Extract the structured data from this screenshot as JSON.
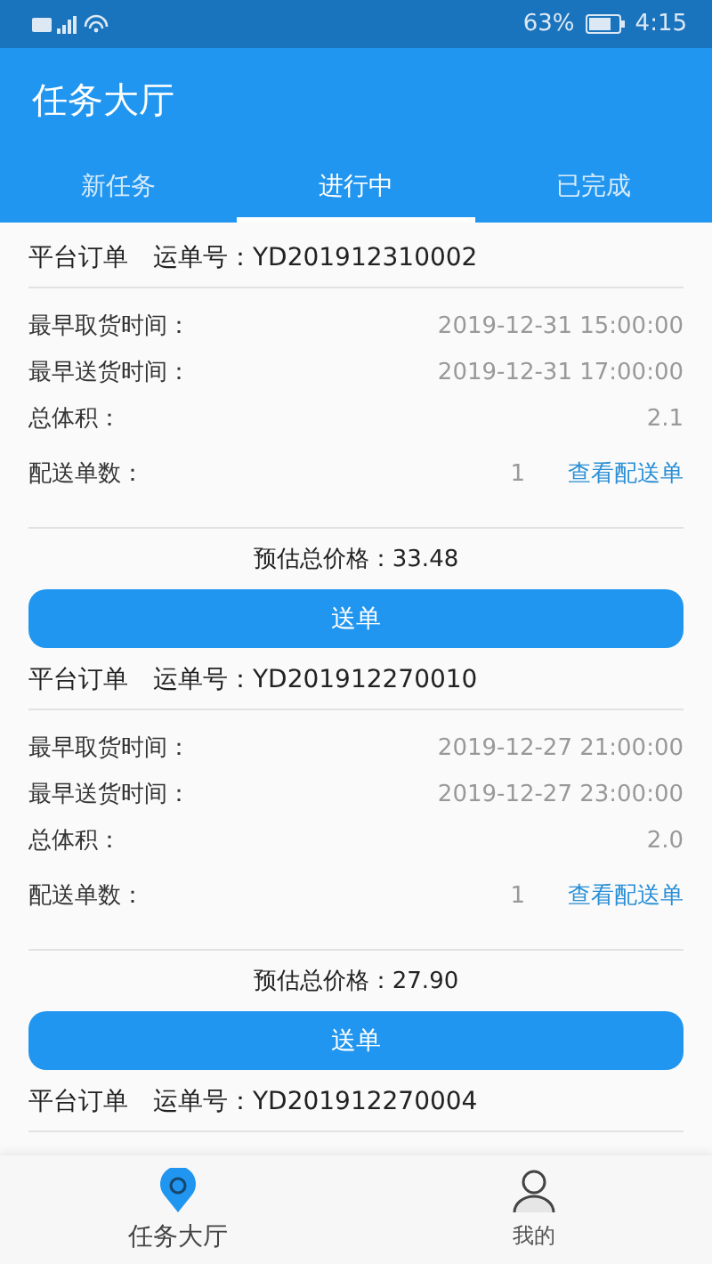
{
  "status_bar": {
    "battery_text": "63%",
    "time": "4:15"
  },
  "header": {
    "title": "任务大厅"
  },
  "tabs": [
    {
      "label": "新任务",
      "selected": false
    },
    {
      "label": "进行中",
      "selected": true
    },
    {
      "label": "已完成",
      "selected": false
    }
  ],
  "orders": [
    {
      "source": "平台订单",
      "waybill_label": "运单号：",
      "waybill": "YD201912310002",
      "fields": [
        {
          "label": "最早取货时间：",
          "value": "2019-12-31 15:00:00"
        },
        {
          "label": "最早送货时间：",
          "value": "2019-12-31 17:00:00"
        },
        {
          "label": "总体积：",
          "value": "2.1"
        },
        {
          "label": "配送单数：",
          "value": "1",
          "link": "查看配送单"
        }
      ],
      "price_label": "预估总价格：",
      "price": "33.48",
      "button": "送单"
    },
    {
      "source": "平台订单",
      "waybill_label": "运单号：",
      "waybill": "YD201912270010",
      "fields": [
        {
          "label": "最早取货时间：",
          "value": "2019-12-27 21:00:00"
        },
        {
          "label": "最早送货时间：",
          "value": "2019-12-27 23:00:00"
        },
        {
          "label": "总体积：",
          "value": "2.0"
        },
        {
          "label": "配送单数：",
          "value": "1",
          "link": "查看配送单"
        }
      ],
      "price_label": "预估总价格：",
      "price": "27.90",
      "button": "送单"
    },
    {
      "source": "平台订单",
      "waybill_label": "运单号：",
      "waybill": "YD201912270004"
    }
  ],
  "bottom_nav": [
    {
      "label": "任务大厅",
      "kind": "pin",
      "selected": true
    },
    {
      "label": "我的",
      "kind": "person",
      "selected": false
    }
  ]
}
